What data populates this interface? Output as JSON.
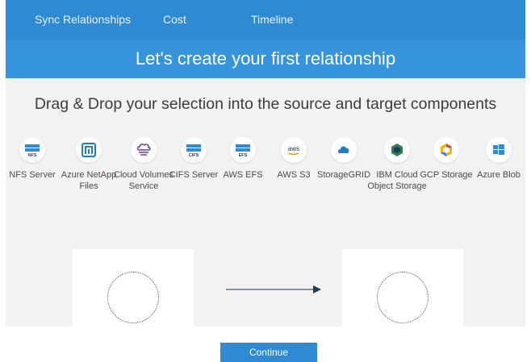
{
  "nav": {
    "tabs": [
      "Sync Relationships",
      "Cost",
      "Timeline"
    ]
  },
  "header": {
    "title": "Let's create your first relationship"
  },
  "instruction": "Drag & Drop your selection into the source and target components",
  "services": [
    {
      "label": "NFS Server",
      "icon": "nfs-server-icon",
      "icon_text": "NFS"
    },
    {
      "label": "Azure NetApp Files",
      "icon": "azure-netapp-files-icon"
    },
    {
      "label": "Cloud Volumes Service",
      "icon": "cloud-volumes-icon"
    },
    {
      "label": "CIFS Server",
      "icon": "cifs-server-icon",
      "icon_text": "CIFS"
    },
    {
      "label": "AWS EFS",
      "icon": "aws-efs-icon",
      "icon_text": "EFS"
    },
    {
      "label": "AWS S3",
      "icon": "aws-s3-icon",
      "icon_text": "aws"
    },
    {
      "label": "StorageGRID",
      "icon": "storagegrid-icon"
    },
    {
      "label": "IBM Cloud Object Storage",
      "icon": "ibm-cloud-icon"
    },
    {
      "label": "GCP Storage",
      "icon": "gcp-storage-icon"
    },
    {
      "label": "Azure Blob",
      "icon": "azure-blob-icon"
    }
  ],
  "footer": {
    "continue_label": "Continue"
  },
  "colors": {
    "nav_bg": "#2d8ad3",
    "header_bg": "#3594dc",
    "content_bg": "#f2f2f2",
    "primary_button": "#2d8ad3"
  }
}
